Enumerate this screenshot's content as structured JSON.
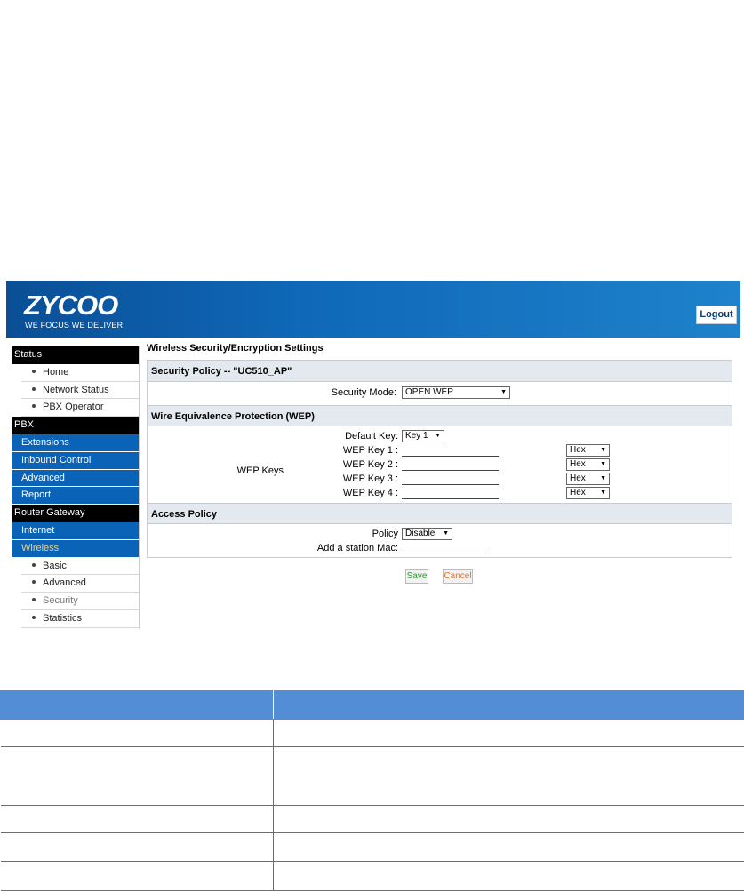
{
  "header": {
    "logo_text": "ZYCOO",
    "tagline": "WE FOCUS WE DELIVER",
    "logout_label": "Logout"
  },
  "sidebar": {
    "sections": [
      {
        "label": "Status",
        "style": "black"
      },
      {
        "label": "Home",
        "style": "sub"
      },
      {
        "label": "Network Status",
        "style": "sub"
      },
      {
        "label": "PBX Operator",
        "style": "sub"
      },
      {
        "label": "PBX",
        "style": "black"
      },
      {
        "label": "Extensions",
        "style": "blue"
      },
      {
        "label": "Inbound Control",
        "style": "blue"
      },
      {
        "label": "Advanced",
        "style": "blue"
      },
      {
        "label": "Report",
        "style": "blue"
      },
      {
        "label": "Router Gateway",
        "style": "black"
      },
      {
        "label": "Internet",
        "style": "blue"
      },
      {
        "label": "Wireless",
        "style": "blue-active"
      },
      {
        "label": "Basic",
        "style": "sub"
      },
      {
        "label": "Advanced",
        "style": "sub"
      },
      {
        "label": "Security",
        "style": "sub-active"
      },
      {
        "label": "Statistics",
        "style": "sub"
      }
    ]
  },
  "main": {
    "page_title": "Wireless Security/Encryption Settings",
    "security_policy": {
      "header": "Security Policy -- \"UC510_AP\"",
      "mode_label": "Security Mode:",
      "mode_value": "OPEN WEP"
    },
    "wep": {
      "header": "Wire Equivalence Protection (WEP)",
      "group_label": "WEP Keys",
      "default_key_label": "Default Key:",
      "default_key_value": "Key 1",
      "keys": [
        {
          "label": "WEP Key 1 :",
          "format": "Hex"
        },
        {
          "label": "WEP Key 2 :",
          "format": "Hex"
        },
        {
          "label": "WEP Key 3 :",
          "format": "Hex"
        },
        {
          "label": "WEP Key 4 :",
          "format": "Hex"
        }
      ]
    },
    "access_policy": {
      "header": "Access Policy",
      "policy_label": "Policy",
      "policy_value": "Disable",
      "mac_label": "Add a station Mac:"
    },
    "buttons": {
      "save": "Save",
      "cancel": "Cancel"
    }
  },
  "colors": {
    "banner_dark": "#0a4f96",
    "banner_light": "#1e82cc",
    "sidebar_blue": "#0a63b7",
    "section_bg": "#e4e9ef",
    "table_header": "#538dd5",
    "save_text": "#2e9e2e",
    "cancel_text": "#e07030"
  },
  "icons": {
    "dropdown": "triangle-down-icon",
    "bullet": "dot-icon"
  }
}
